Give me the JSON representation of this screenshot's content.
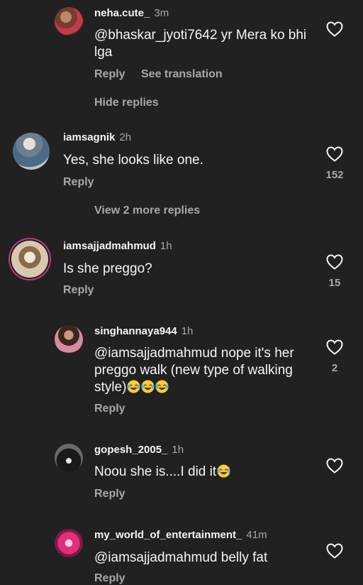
{
  "colors": {
    "background": "#212121",
    "text": "#f5f5f5",
    "muted": "#a8a8a8",
    "story_ring": "#c13584"
  },
  "comments": [
    {
      "username": "neha.cute_",
      "time": "3m",
      "text": "@bhaskar_jyoti7642 yr Mera  ko bhi lga",
      "reply": "Reply",
      "translate": "See translation",
      "likes": "",
      "avatar": "user-photo"
    },
    {
      "username": "iamsagnik",
      "time": "2h",
      "text": "Yes, she looks like one.",
      "reply": "Reply",
      "likes": "152",
      "avatar": "user-photo"
    },
    {
      "username": "iamsajjadmahmud",
      "time": "1h",
      "text": "Is she preggo?",
      "reply": "Reply",
      "likes": "15",
      "avatar": "user-photo"
    },
    {
      "username": "singhannaya944",
      "time": "1h",
      "text": "@iamsajjadmahmud nope it's her preggo walk (new type of walking style)",
      "emoji": "laughing-tears",
      "emoji_count": 3,
      "reply": "Reply",
      "likes": "2",
      "avatar": "user-photo"
    },
    {
      "username": "gopesh_2005_",
      "time": "1h",
      "text": "Noou she is....I did it",
      "emoji": "laughing-tears",
      "emoji_count": 1,
      "reply": "Reply",
      "likes": "",
      "avatar": "user-photo"
    },
    {
      "username": "my_world_of_entertainment_",
      "time": "41m",
      "text": "@iamsajjadmahmud belly fat",
      "reply": "Reply",
      "likes": "",
      "avatar": "user-photo"
    }
  ],
  "hide_replies": "Hide replies",
  "view_more_replies": "View 2 more replies",
  "icons": {
    "like": "heart-outline-icon",
    "emoji": "laughing-tears-emoji"
  }
}
